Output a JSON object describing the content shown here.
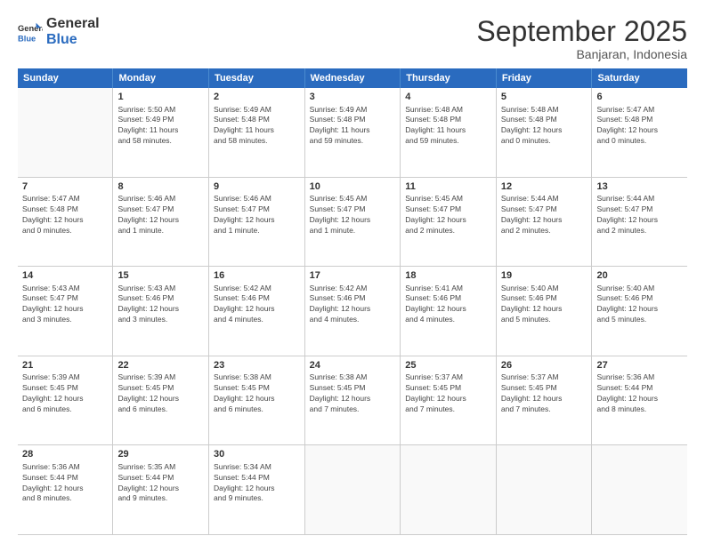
{
  "logo": {
    "line1": "General",
    "line2": "Blue"
  },
  "header": {
    "month": "September 2025",
    "location": "Banjaran, Indonesia"
  },
  "weekdays": [
    "Sunday",
    "Monday",
    "Tuesday",
    "Wednesday",
    "Thursday",
    "Friday",
    "Saturday"
  ],
  "weeks": [
    [
      {
        "day": "",
        "info": ""
      },
      {
        "day": "1",
        "info": "Sunrise: 5:50 AM\nSunset: 5:49 PM\nDaylight: 11 hours\nand 58 minutes."
      },
      {
        "day": "2",
        "info": "Sunrise: 5:49 AM\nSunset: 5:48 PM\nDaylight: 11 hours\nand 58 minutes."
      },
      {
        "day": "3",
        "info": "Sunrise: 5:49 AM\nSunset: 5:48 PM\nDaylight: 11 hours\nand 59 minutes."
      },
      {
        "day": "4",
        "info": "Sunrise: 5:48 AM\nSunset: 5:48 PM\nDaylight: 11 hours\nand 59 minutes."
      },
      {
        "day": "5",
        "info": "Sunrise: 5:48 AM\nSunset: 5:48 PM\nDaylight: 12 hours\nand 0 minutes."
      },
      {
        "day": "6",
        "info": "Sunrise: 5:47 AM\nSunset: 5:48 PM\nDaylight: 12 hours\nand 0 minutes."
      }
    ],
    [
      {
        "day": "7",
        "info": "Sunrise: 5:47 AM\nSunset: 5:48 PM\nDaylight: 12 hours\nand 0 minutes."
      },
      {
        "day": "8",
        "info": "Sunrise: 5:46 AM\nSunset: 5:47 PM\nDaylight: 12 hours\nand 1 minute."
      },
      {
        "day": "9",
        "info": "Sunrise: 5:46 AM\nSunset: 5:47 PM\nDaylight: 12 hours\nand 1 minute."
      },
      {
        "day": "10",
        "info": "Sunrise: 5:45 AM\nSunset: 5:47 PM\nDaylight: 12 hours\nand 1 minute."
      },
      {
        "day": "11",
        "info": "Sunrise: 5:45 AM\nSunset: 5:47 PM\nDaylight: 12 hours\nand 2 minutes."
      },
      {
        "day": "12",
        "info": "Sunrise: 5:44 AM\nSunset: 5:47 PM\nDaylight: 12 hours\nand 2 minutes."
      },
      {
        "day": "13",
        "info": "Sunrise: 5:44 AM\nSunset: 5:47 PM\nDaylight: 12 hours\nand 2 minutes."
      }
    ],
    [
      {
        "day": "14",
        "info": "Sunrise: 5:43 AM\nSunset: 5:47 PM\nDaylight: 12 hours\nand 3 minutes."
      },
      {
        "day": "15",
        "info": "Sunrise: 5:43 AM\nSunset: 5:46 PM\nDaylight: 12 hours\nand 3 minutes."
      },
      {
        "day": "16",
        "info": "Sunrise: 5:42 AM\nSunset: 5:46 PM\nDaylight: 12 hours\nand 4 minutes."
      },
      {
        "day": "17",
        "info": "Sunrise: 5:42 AM\nSunset: 5:46 PM\nDaylight: 12 hours\nand 4 minutes."
      },
      {
        "day": "18",
        "info": "Sunrise: 5:41 AM\nSunset: 5:46 PM\nDaylight: 12 hours\nand 4 minutes."
      },
      {
        "day": "19",
        "info": "Sunrise: 5:40 AM\nSunset: 5:46 PM\nDaylight: 12 hours\nand 5 minutes."
      },
      {
        "day": "20",
        "info": "Sunrise: 5:40 AM\nSunset: 5:46 PM\nDaylight: 12 hours\nand 5 minutes."
      }
    ],
    [
      {
        "day": "21",
        "info": "Sunrise: 5:39 AM\nSunset: 5:45 PM\nDaylight: 12 hours\nand 6 minutes."
      },
      {
        "day": "22",
        "info": "Sunrise: 5:39 AM\nSunset: 5:45 PM\nDaylight: 12 hours\nand 6 minutes."
      },
      {
        "day": "23",
        "info": "Sunrise: 5:38 AM\nSunset: 5:45 PM\nDaylight: 12 hours\nand 6 minutes."
      },
      {
        "day": "24",
        "info": "Sunrise: 5:38 AM\nSunset: 5:45 PM\nDaylight: 12 hours\nand 7 minutes."
      },
      {
        "day": "25",
        "info": "Sunrise: 5:37 AM\nSunset: 5:45 PM\nDaylight: 12 hours\nand 7 minutes."
      },
      {
        "day": "26",
        "info": "Sunrise: 5:37 AM\nSunset: 5:45 PM\nDaylight: 12 hours\nand 7 minutes."
      },
      {
        "day": "27",
        "info": "Sunrise: 5:36 AM\nSunset: 5:44 PM\nDaylight: 12 hours\nand 8 minutes."
      }
    ],
    [
      {
        "day": "28",
        "info": "Sunrise: 5:36 AM\nSunset: 5:44 PM\nDaylight: 12 hours\nand 8 minutes."
      },
      {
        "day": "29",
        "info": "Sunrise: 5:35 AM\nSunset: 5:44 PM\nDaylight: 12 hours\nand 9 minutes."
      },
      {
        "day": "30",
        "info": "Sunrise: 5:34 AM\nSunset: 5:44 PM\nDaylight: 12 hours\nand 9 minutes."
      },
      {
        "day": "",
        "info": ""
      },
      {
        "day": "",
        "info": ""
      },
      {
        "day": "",
        "info": ""
      },
      {
        "day": "",
        "info": ""
      }
    ]
  ]
}
